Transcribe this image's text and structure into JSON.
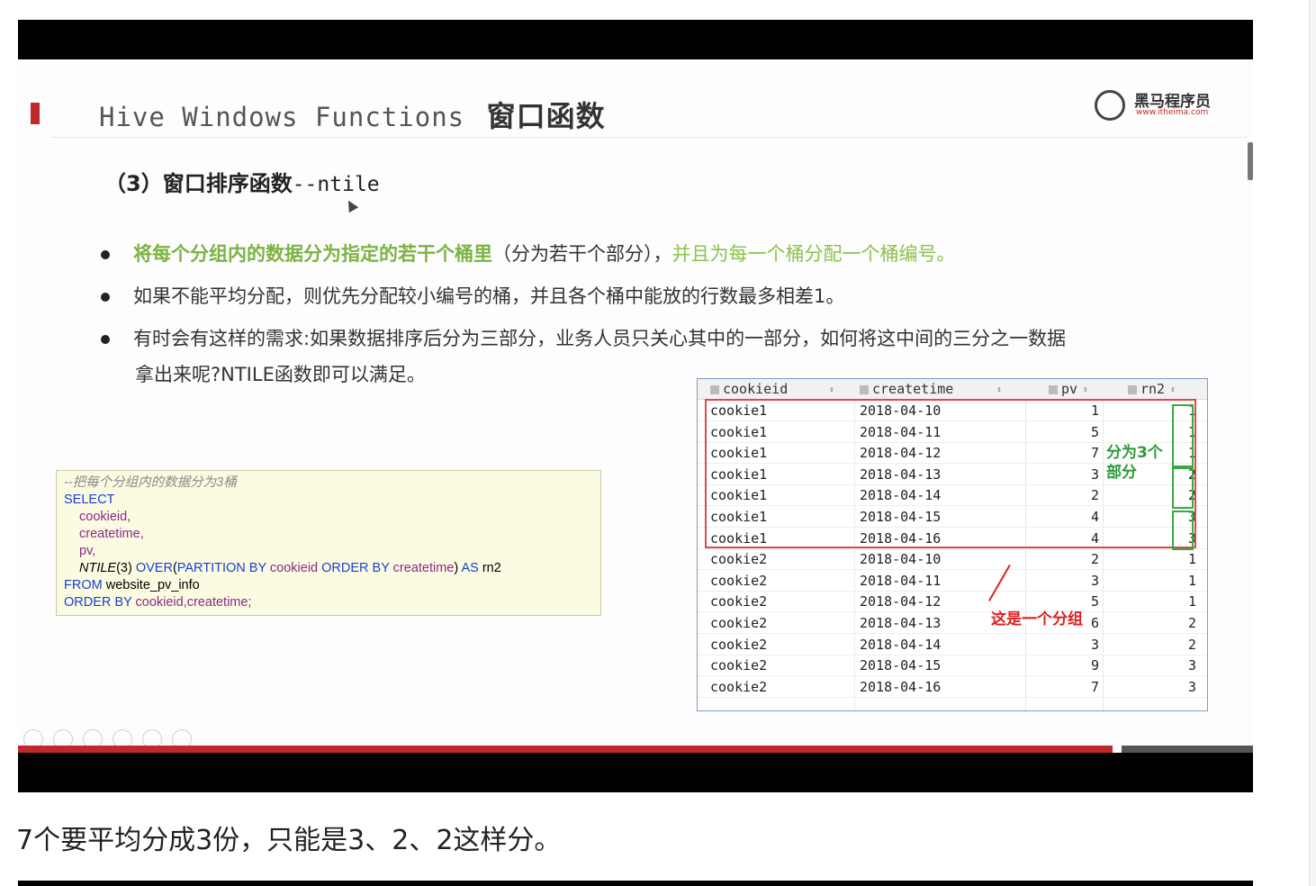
{
  "slide": {
    "title_en": "Hive Windows Functions",
    "title_zh": "窗口函数",
    "logo_text": "黑马程序员",
    "logo_url": "www.itheima.com",
    "subtitle_zh": "（3）窗口排序函数",
    "subtitle_code": "--ntile",
    "bullet1_part1": "将每个分组内的数据分为指定的若干个桶里",
    "bullet1_part2": "（分为若干个部分），",
    "bullet1_part3": "并且为每一个桶分配一个桶编号。",
    "bullet2": "如果不能平均分配，则优先分配较小编号的桶，并且各个桶中能放的行数最多相差1。",
    "bullet3_line1": "有时会有这样的需求:如果数据排序后分为三部分，业务人员只关心其中的一部分，如何将这中间的三分之一数据",
    "bullet3_line2": "拿出来呢?NTILE函数即可以满足。"
  },
  "sql": {
    "comment": "--把每个分组内的数据分为3桶",
    "select": "SELECT",
    "col1": "cookieid,",
    "col2": "createtime,",
    "col3": "pv,",
    "ntile_fn": "NTILE",
    "ntile_arg": "(3) ",
    "over": "OVER",
    "paren_open": "(",
    "partition_by": "PARTITION BY ",
    "partition_col": "cookieid ",
    "order_by_inner": "ORDER BY ",
    "order_col": "createtime",
    "paren_close": ") ",
    "as_kw": "AS ",
    "alias": "rn2",
    "from_kw": "FROM ",
    "table": "website_pv_info",
    "order_by": "ORDER BY ",
    "order_cols": "cookieid,createtime;"
  },
  "table": {
    "headers": [
      "cookieid",
      "createtime",
      "pv",
      "rn2"
    ],
    "rows": [
      [
        "cookie1",
        "2018-04-10",
        "1",
        "1"
      ],
      [
        "cookie1",
        "2018-04-11",
        "5",
        "1"
      ],
      [
        "cookie1",
        "2018-04-12",
        "7",
        "1"
      ],
      [
        "cookie1",
        "2018-04-13",
        "3",
        "2"
      ],
      [
        "cookie1",
        "2018-04-14",
        "2",
        "2"
      ],
      [
        "cookie1",
        "2018-04-15",
        "4",
        "3"
      ],
      [
        "cookie1",
        "2018-04-16",
        "4",
        "3"
      ],
      [
        "cookie2",
        "2018-04-10",
        "2",
        "1"
      ],
      [
        "cookie2",
        "2018-04-11",
        "3",
        "1"
      ],
      [
        "cookie2",
        "2018-04-12",
        "5",
        "1"
      ],
      [
        "cookie2",
        "2018-04-13",
        "6",
        "2"
      ],
      [
        "cookie2",
        "2018-04-14",
        "3",
        "2"
      ],
      [
        "cookie2",
        "2018-04-15",
        "9",
        "3"
      ],
      [
        "cookie2",
        "2018-04-16",
        "7",
        "3"
      ]
    ],
    "annotation_green": "分为3个部分",
    "annotation_red": "这是一个分组"
  },
  "caption": "7个要平均分成3份，只能是3、2、2这样分。",
  "colors": {
    "accent_red": "#c0282c",
    "highlight_green": "#7cb342",
    "annotation_green": "#2e9b3a",
    "annotation_red": "#e02020"
  }
}
